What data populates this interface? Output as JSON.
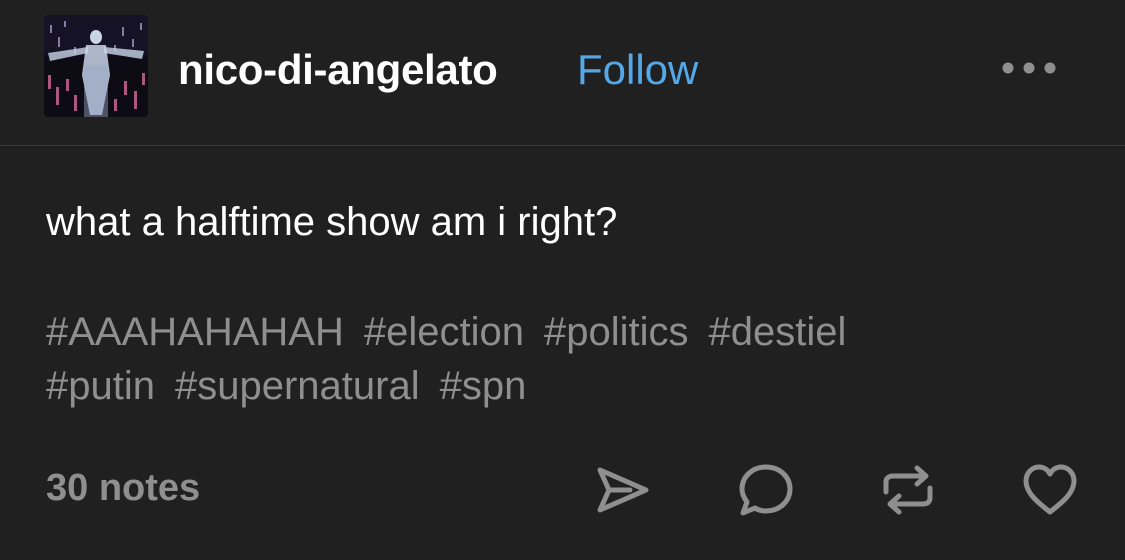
{
  "post": {
    "username": "nico-di-angelato",
    "follow_label": "Follow",
    "body": "what a halftime show am i right?",
    "tags": [
      "#AAAHAHAHAH",
      "#election",
      "#politics",
      "#destiel",
      "#putin",
      "#supernatural",
      "#spn"
    ],
    "notes": "30 notes"
  },
  "icons": {
    "more": "more-options-icon",
    "share": "share-icon",
    "reply": "reply-icon",
    "reblog": "reblog-icon",
    "like": "heart-icon"
  },
  "colors": {
    "background": "#202020",
    "link": "#54a8e8",
    "muted": "#8f8f8f",
    "text": "#ffffff"
  }
}
